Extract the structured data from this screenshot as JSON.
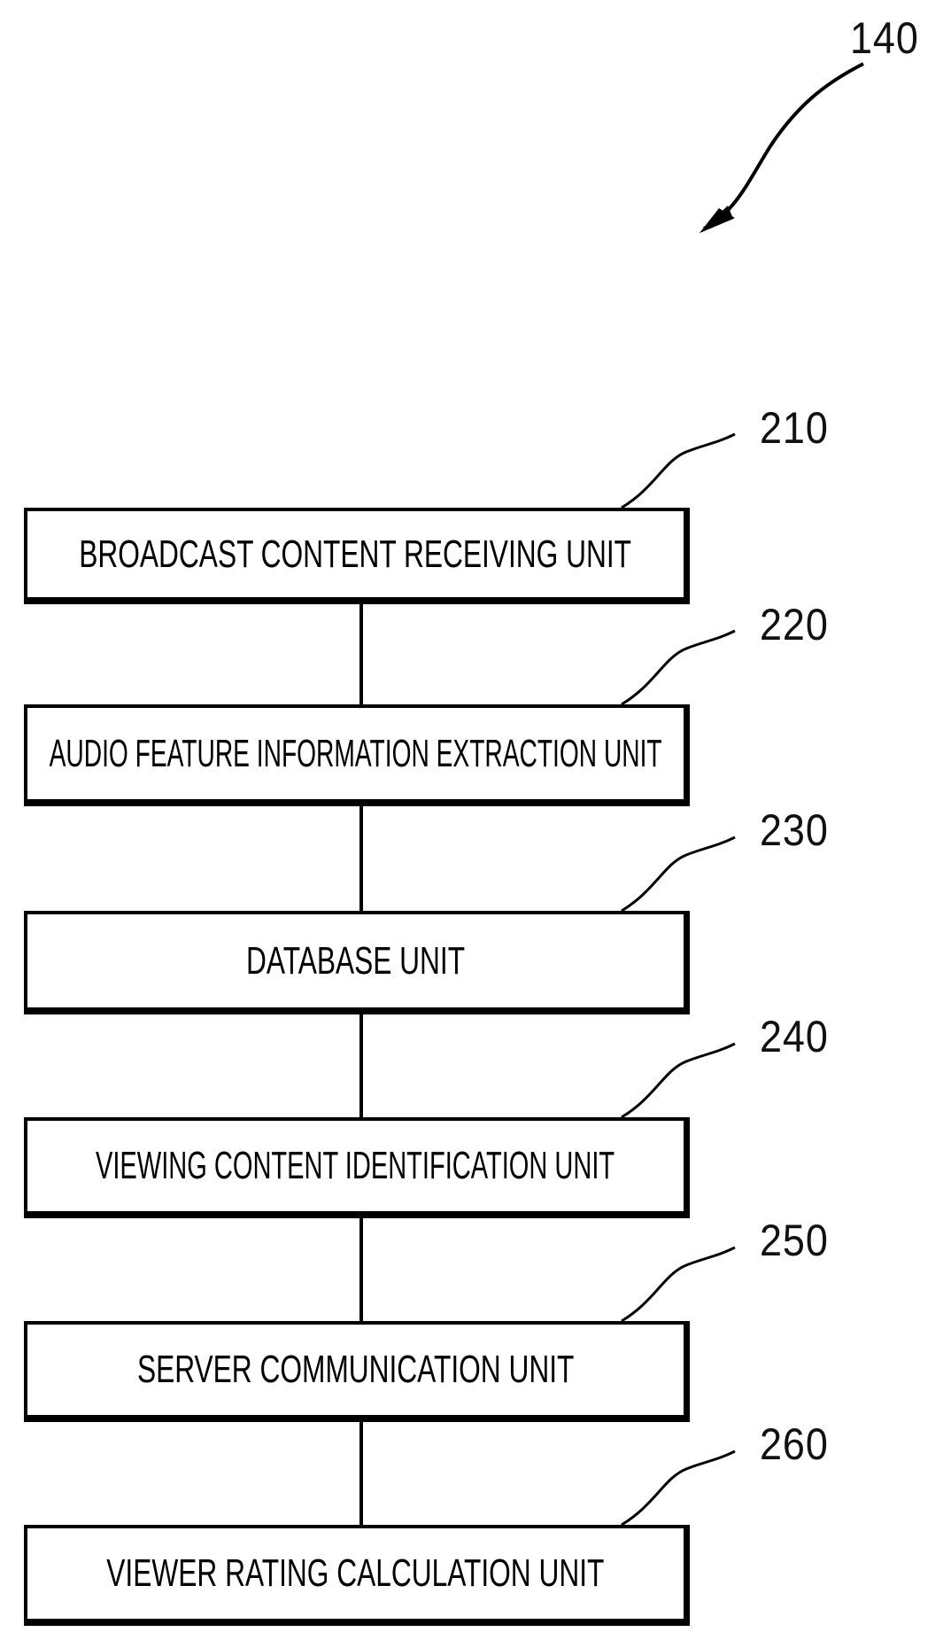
{
  "figure": {
    "overall_reference": "140",
    "connector_color": "#000000",
    "units": [
      {
        "ref": "210",
        "label": "BROADCAST CONTENT RECEIVING UNIT"
      },
      {
        "ref": "220",
        "label": "AUDIO FEATURE INFORMATION EXTRACTION UNIT"
      },
      {
        "ref": "230",
        "label": "DATABASE UNIT"
      },
      {
        "ref": "240",
        "label": "VIEWING CONTENT IDENTIFICATION UNIT"
      },
      {
        "ref": "250",
        "label": "SERVER COMMUNICATION UNIT"
      },
      {
        "ref": "260",
        "label": "VIEWER RATING CALCULATION UNIT"
      }
    ]
  }
}
